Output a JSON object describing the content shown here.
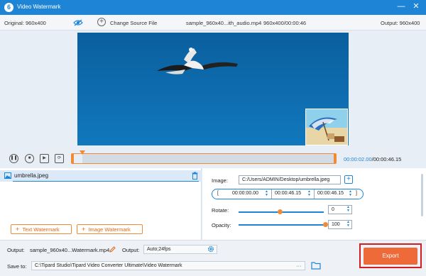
{
  "window": {
    "title": "Video Watermark",
    "min_glyph": "—",
    "close_glyph": "✕",
    "logo_glyph": "6"
  },
  "infobar": {
    "original": "Original: 960x400",
    "change_source": "Change Source File",
    "filename": "sample_960x40...ith_audio.mp4",
    "resolution_duration": "960x400/00:00:46",
    "output": "Output: 960x400"
  },
  "playback": {
    "current_time": "00:00:02.00",
    "total_time": "/00:00:46.15",
    "progress": 0.04
  },
  "layers": {
    "items": [
      {
        "label": "umbrella.jpeg"
      }
    ],
    "text_watermark": "Text Watermark",
    "image_watermark": "Image Watermark",
    "plus_glyph": "+"
  },
  "settings": {
    "image_label": "Image:",
    "image_path": "C:/Users/ADMIN/Desktop/umbrella.jpeg",
    "start_time": "00:00:00.00",
    "end_time": "00:00:46.15",
    "rotate_label": "Rotate:",
    "rotate_value": "0",
    "rotate_level": 0.49,
    "opacity_label": "Opacity:",
    "opacity_value": "100",
    "opacity_level": 1.0
  },
  "bottom": {
    "output_label": "Output:",
    "output_name": "sample_960x40...Watermark.mp4",
    "output_format_label": "Output:",
    "output_format": "Auto;24fps",
    "save_to_label": "Save to:",
    "save_path": "C:\\Tipard Studio\\Tipard Video Converter Ultimate\\Video Watermark",
    "more_glyph": "···",
    "export_label": "Export"
  },
  "icons": [
    "eye-off-icon",
    "plus-circle-icon",
    "trash-icon",
    "image-icon",
    "edit-icon",
    "gear-icon",
    "folder-icon",
    "play-icon",
    "stop-icon",
    "next-frame-icon",
    "loop-icon"
  ],
  "colors": {
    "accent": "#1e84d6",
    "export": "#ee6a38",
    "highlight_frame": "#d21e1e",
    "orange": "#f28a33"
  }
}
